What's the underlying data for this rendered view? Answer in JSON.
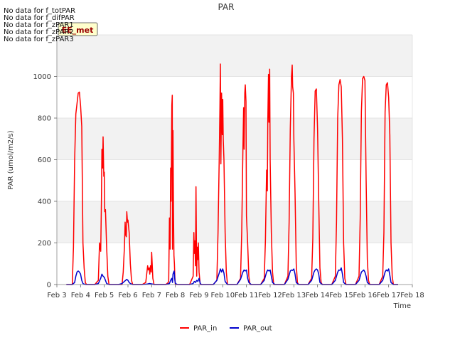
{
  "chart_data": {
    "type": "line",
    "title": "PAR",
    "xlabel": "Time",
    "ylabel": "PAR (umol/m2/s)",
    "xlim": [
      3.0,
      18.0
    ],
    "ylim": [
      0,
      1200
    ],
    "x_ticks": [
      3,
      4,
      5,
      6,
      7,
      8,
      9,
      10,
      11,
      12,
      13,
      14,
      15,
      16,
      17,
      18
    ],
    "x_tick_labels": [
      "Feb 3",
      "Feb 4",
      "Feb 5",
      "Feb 6",
      "Feb 7",
      "Feb 8",
      "Feb 9",
      "Feb 10",
      "Feb 11",
      "Feb 12",
      "Feb 13",
      "Feb 14",
      "Feb 15",
      "Feb 16",
      "Feb 17",
      "Feb 18"
    ],
    "y_ticks": [
      0,
      200,
      400,
      600,
      800,
      1000
    ],
    "y_tick_labels": [
      "0",
      "200",
      "400",
      "600",
      "800",
      "1000"
    ],
    "background_bands": true,
    "legend_position": "bottom-center",
    "no_data_messages": [
      "No data for f_totPAR",
      "No data for f_difPAR",
      "No data for f_zPAR1",
      "No data for f_zPAR2",
      "No data for f_zPAR3"
    ],
    "badge_text": "EE_met",
    "series": [
      {
        "name": "PAR_in",
        "color": "#ff0000",
        "x": [
          3.4,
          3.65,
          3.7,
          3.75,
          3.8,
          3.85,
          3.9,
          3.95,
          4.0,
          4.05,
          4.1,
          4.15,
          4.2,
          4.25,
          4.3,
          4.35,
          4.6,
          4.75,
          4.8,
          4.85,
          4.88,
          4.9,
          4.93,
          4.95,
          4.98,
          5.0,
          5.02,
          5.05,
          5.1,
          5.15,
          5.2,
          5.6,
          5.75,
          5.8,
          5.85,
          5.88,
          5.9,
          5.93,
          5.95,
          5.98,
          6.0,
          6.05,
          6.1,
          6.15,
          6.2,
          6.6,
          6.75,
          6.8,
          6.83,
          6.86,
          6.9,
          6.92,
          6.95,
          6.98,
          7.0,
          7.05,
          7.1,
          7.3,
          7.6,
          7.7,
          7.72,
          7.75,
          7.78,
          7.8,
          7.82,
          7.85,
          7.87,
          7.88,
          7.9,
          7.92,
          7.94,
          7.96,
          7.98,
          8.0,
          8.05,
          8.1,
          8.6,
          8.75,
          8.78,
          8.8,
          8.82,
          8.85,
          8.87,
          8.9,
          8.92,
          8.95,
          8.97,
          9.0,
          9.05,
          9.1,
          9.6,
          9.75,
          9.8,
          9.85,
          9.88,
          9.9,
          9.92,
          9.95,
          9.98,
          10.0,
          10.02,
          10.05,
          10.1,
          10.15,
          10.2,
          10.6,
          10.75,
          10.8,
          10.85,
          10.88,
          10.9,
          10.93,
          10.95,
          10.98,
          11.0,
          11.05,
          11.1,
          11.15,
          11.2,
          11.6,
          11.75,
          11.8,
          11.85,
          11.88,
          11.9,
          11.93,
          11.95,
          11.98,
          12.0,
          12.05,
          12.1,
          12.15,
          12.2,
          12.6,
          12.75,
          12.8,
          12.85,
          12.9,
          12.93,
          12.95,
          12.98,
          13.0,
          13.05,
          13.1,
          13.15,
          13.2,
          13.6,
          13.75,
          13.8,
          13.85,
          13.9,
          13.95,
          14.0,
          14.05,
          14.1,
          14.15,
          14.2,
          14.6,
          14.75,
          14.8,
          14.85,
          14.9,
          14.95,
          15.0,
          15.05,
          15.1,
          15.15,
          15.2,
          15.6,
          15.75,
          15.8,
          15.85,
          15.9,
          15.95,
          16.0,
          16.05,
          16.1,
          16.15,
          16.2,
          16.6,
          16.75,
          16.8,
          16.85,
          16.9,
          16.95,
          17.0,
          17.05,
          17.1,
          17.15,
          17.2,
          17.4
        ],
        "y": [
          0,
          0,
          180,
          600,
          820,
          870,
          920,
          925,
          860,
          760,
          200,
          80,
          10,
          0,
          0,
          0,
          0,
          20,
          200,
          160,
          400,
          650,
          560,
          710,
          520,
          540,
          350,
          360,
          180,
          40,
          0,
          0,
          0,
          60,
          180,
          300,
          240,
          230,
          350,
          300,
          310,
          250,
          100,
          20,
          0,
          0,
          10,
          60,
          90,
          70,
          80,
          50,
          90,
          60,
          155,
          30,
          0,
          0,
          0,
          10,
          20,
          320,
          170,
          560,
          400,
          860,
          910,
          170,
          740,
          360,
          140,
          100,
          30,
          0,
          0,
          0,
          0,
          40,
          250,
          150,
          210,
          90,
          470,
          40,
          180,
          120,
          200,
          60,
          0,
          0,
          0,
          20,
          250,
          600,
          850,
          1060,
          580,
          920,
          720,
          890,
          700,
          600,
          250,
          60,
          0,
          0,
          30,
          250,
          650,
          850,
          650,
          920,
          960,
          880,
          330,
          200,
          40,
          0,
          0,
          0,
          30,
          210,
          550,
          450,
          780,
          1010,
          780,
          1035,
          600,
          250,
          60,
          0,
          0,
          0,
          40,
          300,
          750,
          1000,
          1055,
          950,
          920,
          700,
          440,
          100,
          10,
          0,
          0,
          30,
          220,
          700,
          930,
          940,
          750,
          400,
          80,
          10,
          0,
          0,
          40,
          300,
          800,
          960,
          985,
          950,
          700,
          200,
          30,
          0,
          0,
          40,
          320,
          830,
          990,
          1000,
          980,
          500,
          120,
          20,
          0,
          0,
          40,
          250,
          830,
          960,
          970,
          900,
          720,
          200,
          40,
          0,
          0
        ],
        "line_width": 1.5
      },
      {
        "name": "PAR_out",
        "color": "#0000cc",
        "x": [
          3.4,
          3.65,
          3.75,
          3.8,
          3.85,
          3.9,
          3.95,
          4.0,
          4.05,
          4.1,
          4.2,
          4.6,
          4.75,
          4.85,
          4.9,
          4.95,
          5.0,
          5.05,
          5.1,
          5.2,
          5.6,
          5.75,
          5.85,
          5.9,
          5.95,
          6.0,
          6.05,
          6.1,
          6.2,
          6.6,
          6.8,
          6.9,
          7.0,
          7.05,
          7.1,
          7.6,
          7.75,
          7.8,
          7.85,
          7.88,
          7.9,
          7.93,
          7.95,
          7.98,
          8.0,
          8.1,
          8.6,
          8.75,
          8.8,
          8.85,
          8.9,
          8.95,
          9.0,
          9.05,
          9.1,
          9.6,
          9.75,
          9.85,
          9.9,
          9.95,
          10.0,
          10.05,
          10.1,
          10.2,
          10.6,
          10.75,
          10.85,
          10.9,
          10.95,
          11.0,
          11.05,
          11.1,
          11.2,
          11.6,
          11.75,
          11.85,
          11.9,
          11.95,
          12.0,
          12.05,
          12.1,
          12.2,
          12.6,
          12.75,
          12.85,
          12.9,
          12.95,
          13.0,
          13.05,
          13.1,
          13.2,
          13.6,
          13.75,
          13.85,
          13.9,
          13.95,
          14.0,
          14.05,
          14.1,
          14.2,
          14.6,
          14.75,
          14.85,
          14.9,
          14.95,
          15.0,
          15.05,
          15.1,
          15.2,
          15.6,
          15.75,
          15.85,
          15.9,
          15.95,
          16.0,
          16.05,
          16.1,
          16.2,
          16.6,
          16.75,
          16.85,
          16.9,
          16.95,
          17.0,
          17.05,
          17.1,
          17.2,
          17.4
        ],
        "y": [
          0,
          0,
          10,
          40,
          60,
          65,
          60,
          50,
          20,
          5,
          0,
          0,
          5,
          30,
          50,
          40,
          35,
          20,
          5,
          0,
          0,
          5,
          15,
          20,
          25,
          20,
          10,
          5,
          0,
          0,
          2,
          5,
          3,
          2,
          0,
          0,
          5,
          20,
          30,
          10,
          50,
          60,
          65,
          20,
          5,
          0,
          0,
          5,
          15,
          10,
          20,
          15,
          30,
          5,
          0,
          0,
          20,
          55,
          75,
          60,
          75,
          55,
          15,
          0,
          0,
          25,
          60,
          70,
          65,
          70,
          30,
          10,
          0,
          0,
          20,
          60,
          70,
          65,
          70,
          40,
          10,
          0,
          0,
          25,
          65,
          70,
          68,
          75,
          50,
          10,
          0,
          0,
          20,
          60,
          70,
          75,
          70,
          50,
          10,
          0,
          0,
          20,
          60,
          70,
          68,
          80,
          50,
          10,
          0,
          0,
          20,
          60,
          65,
          70,
          60,
          40,
          10,
          0,
          0,
          20,
          60,
          70,
          65,
          75,
          45,
          10,
          0,
          0
        ],
        "line_width": 1.5
      }
    ]
  }
}
